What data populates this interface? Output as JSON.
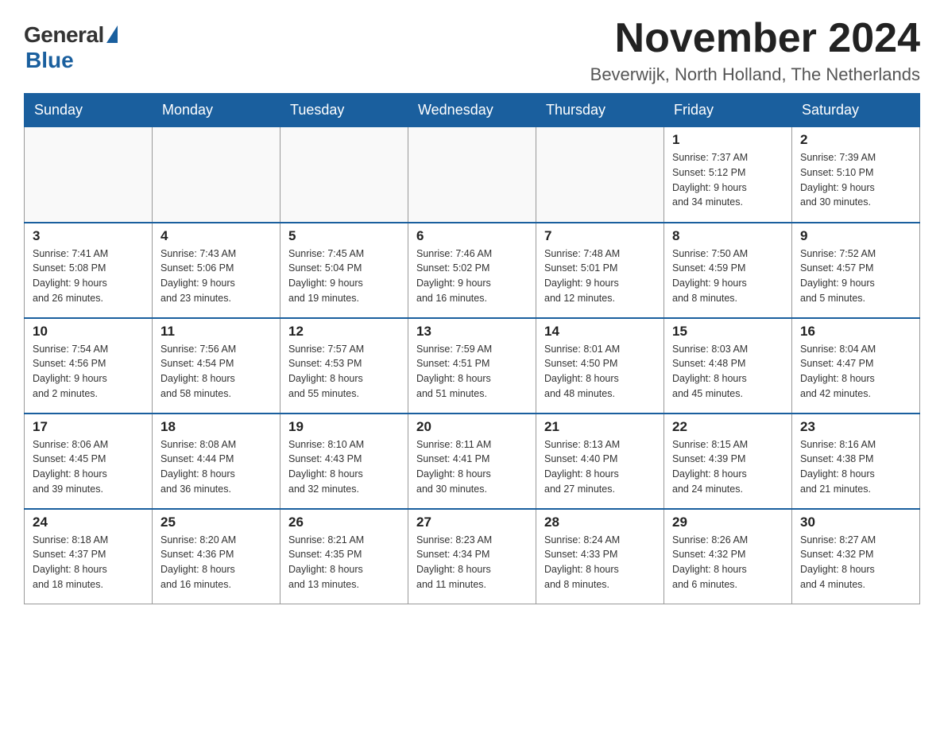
{
  "logo": {
    "general": "General",
    "blue": "Blue"
  },
  "title": "November 2024",
  "subtitle": "Beverwijk, North Holland, The Netherlands",
  "days_of_week": [
    "Sunday",
    "Monday",
    "Tuesday",
    "Wednesday",
    "Thursday",
    "Friday",
    "Saturday"
  ],
  "weeks": [
    [
      {
        "day": "",
        "info": ""
      },
      {
        "day": "",
        "info": ""
      },
      {
        "day": "",
        "info": ""
      },
      {
        "day": "",
        "info": ""
      },
      {
        "day": "",
        "info": ""
      },
      {
        "day": "1",
        "info": "Sunrise: 7:37 AM\nSunset: 5:12 PM\nDaylight: 9 hours\nand 34 minutes."
      },
      {
        "day": "2",
        "info": "Sunrise: 7:39 AM\nSunset: 5:10 PM\nDaylight: 9 hours\nand 30 minutes."
      }
    ],
    [
      {
        "day": "3",
        "info": "Sunrise: 7:41 AM\nSunset: 5:08 PM\nDaylight: 9 hours\nand 26 minutes."
      },
      {
        "day": "4",
        "info": "Sunrise: 7:43 AM\nSunset: 5:06 PM\nDaylight: 9 hours\nand 23 minutes."
      },
      {
        "day": "5",
        "info": "Sunrise: 7:45 AM\nSunset: 5:04 PM\nDaylight: 9 hours\nand 19 minutes."
      },
      {
        "day": "6",
        "info": "Sunrise: 7:46 AM\nSunset: 5:02 PM\nDaylight: 9 hours\nand 16 minutes."
      },
      {
        "day": "7",
        "info": "Sunrise: 7:48 AM\nSunset: 5:01 PM\nDaylight: 9 hours\nand 12 minutes."
      },
      {
        "day": "8",
        "info": "Sunrise: 7:50 AM\nSunset: 4:59 PM\nDaylight: 9 hours\nand 8 minutes."
      },
      {
        "day": "9",
        "info": "Sunrise: 7:52 AM\nSunset: 4:57 PM\nDaylight: 9 hours\nand 5 minutes."
      }
    ],
    [
      {
        "day": "10",
        "info": "Sunrise: 7:54 AM\nSunset: 4:56 PM\nDaylight: 9 hours\nand 2 minutes."
      },
      {
        "day": "11",
        "info": "Sunrise: 7:56 AM\nSunset: 4:54 PM\nDaylight: 8 hours\nand 58 minutes."
      },
      {
        "day": "12",
        "info": "Sunrise: 7:57 AM\nSunset: 4:53 PM\nDaylight: 8 hours\nand 55 minutes."
      },
      {
        "day": "13",
        "info": "Sunrise: 7:59 AM\nSunset: 4:51 PM\nDaylight: 8 hours\nand 51 minutes."
      },
      {
        "day": "14",
        "info": "Sunrise: 8:01 AM\nSunset: 4:50 PM\nDaylight: 8 hours\nand 48 minutes."
      },
      {
        "day": "15",
        "info": "Sunrise: 8:03 AM\nSunset: 4:48 PM\nDaylight: 8 hours\nand 45 minutes."
      },
      {
        "day": "16",
        "info": "Sunrise: 8:04 AM\nSunset: 4:47 PM\nDaylight: 8 hours\nand 42 minutes."
      }
    ],
    [
      {
        "day": "17",
        "info": "Sunrise: 8:06 AM\nSunset: 4:45 PM\nDaylight: 8 hours\nand 39 minutes."
      },
      {
        "day": "18",
        "info": "Sunrise: 8:08 AM\nSunset: 4:44 PM\nDaylight: 8 hours\nand 36 minutes."
      },
      {
        "day": "19",
        "info": "Sunrise: 8:10 AM\nSunset: 4:43 PM\nDaylight: 8 hours\nand 32 minutes."
      },
      {
        "day": "20",
        "info": "Sunrise: 8:11 AM\nSunset: 4:41 PM\nDaylight: 8 hours\nand 30 minutes."
      },
      {
        "day": "21",
        "info": "Sunrise: 8:13 AM\nSunset: 4:40 PM\nDaylight: 8 hours\nand 27 minutes."
      },
      {
        "day": "22",
        "info": "Sunrise: 8:15 AM\nSunset: 4:39 PM\nDaylight: 8 hours\nand 24 minutes."
      },
      {
        "day": "23",
        "info": "Sunrise: 8:16 AM\nSunset: 4:38 PM\nDaylight: 8 hours\nand 21 minutes."
      }
    ],
    [
      {
        "day": "24",
        "info": "Sunrise: 8:18 AM\nSunset: 4:37 PM\nDaylight: 8 hours\nand 18 minutes."
      },
      {
        "day": "25",
        "info": "Sunrise: 8:20 AM\nSunset: 4:36 PM\nDaylight: 8 hours\nand 16 minutes."
      },
      {
        "day": "26",
        "info": "Sunrise: 8:21 AM\nSunset: 4:35 PM\nDaylight: 8 hours\nand 13 minutes."
      },
      {
        "day": "27",
        "info": "Sunrise: 8:23 AM\nSunset: 4:34 PM\nDaylight: 8 hours\nand 11 minutes."
      },
      {
        "day": "28",
        "info": "Sunrise: 8:24 AM\nSunset: 4:33 PM\nDaylight: 8 hours\nand 8 minutes."
      },
      {
        "day": "29",
        "info": "Sunrise: 8:26 AM\nSunset: 4:32 PM\nDaylight: 8 hours\nand 6 minutes."
      },
      {
        "day": "30",
        "info": "Sunrise: 8:27 AM\nSunset: 4:32 PM\nDaylight: 8 hours\nand 4 minutes."
      }
    ]
  ]
}
